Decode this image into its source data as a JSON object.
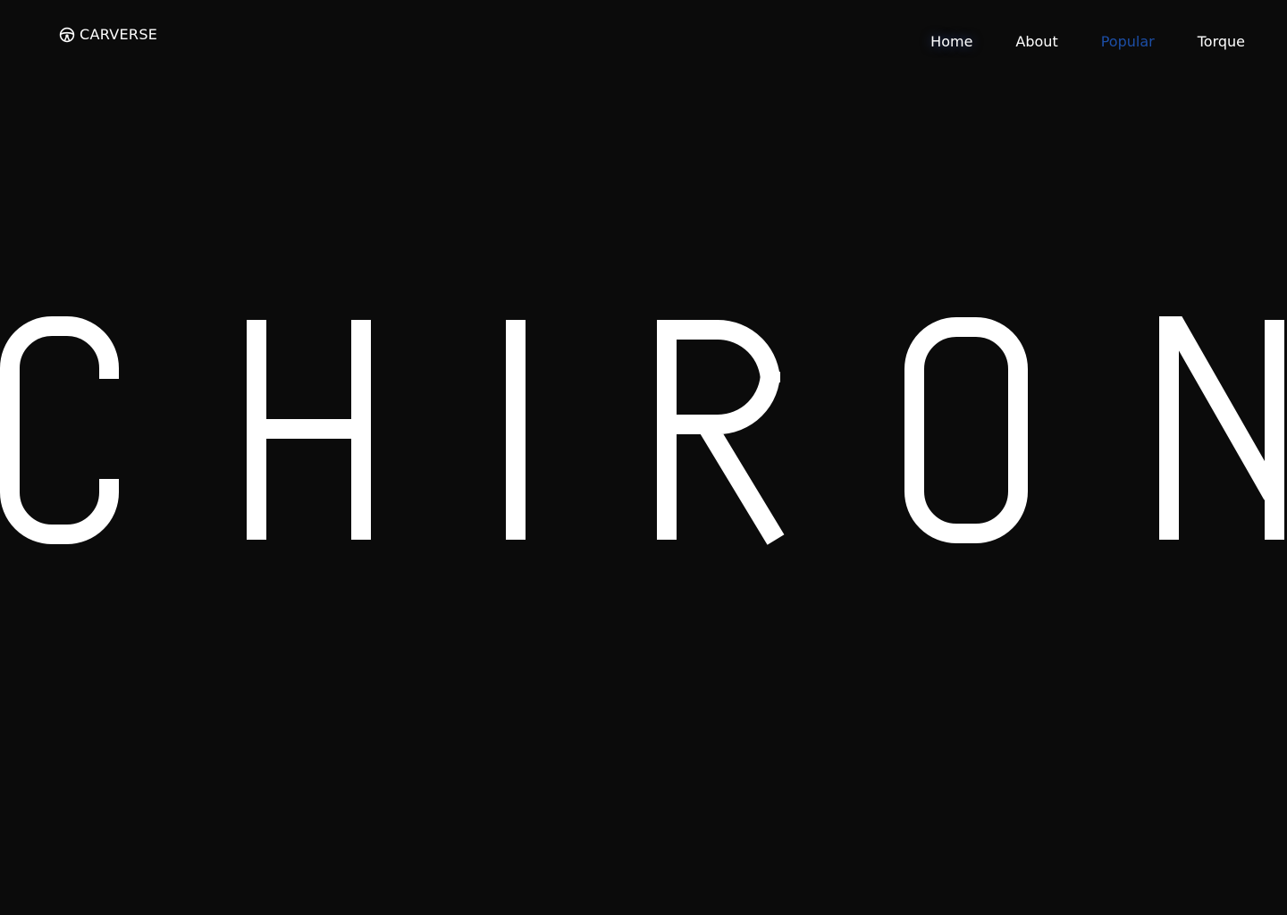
{
  "brand": {
    "name": "CARVERSE",
    "icon": "steering-wheel-icon"
  },
  "nav": {
    "items": [
      {
        "label": "Home",
        "state": "hovered"
      },
      {
        "label": "About",
        "state": "default"
      },
      {
        "label": "Popular",
        "state": "active"
      },
      {
        "label": "Torque",
        "state": "default"
      }
    ]
  },
  "hero": {
    "title": "CHIRON"
  },
  "colors": {
    "background": "#0b0b0b",
    "text": "#ffffff",
    "active": "#1c4ea6",
    "glow": "#2846aa"
  }
}
